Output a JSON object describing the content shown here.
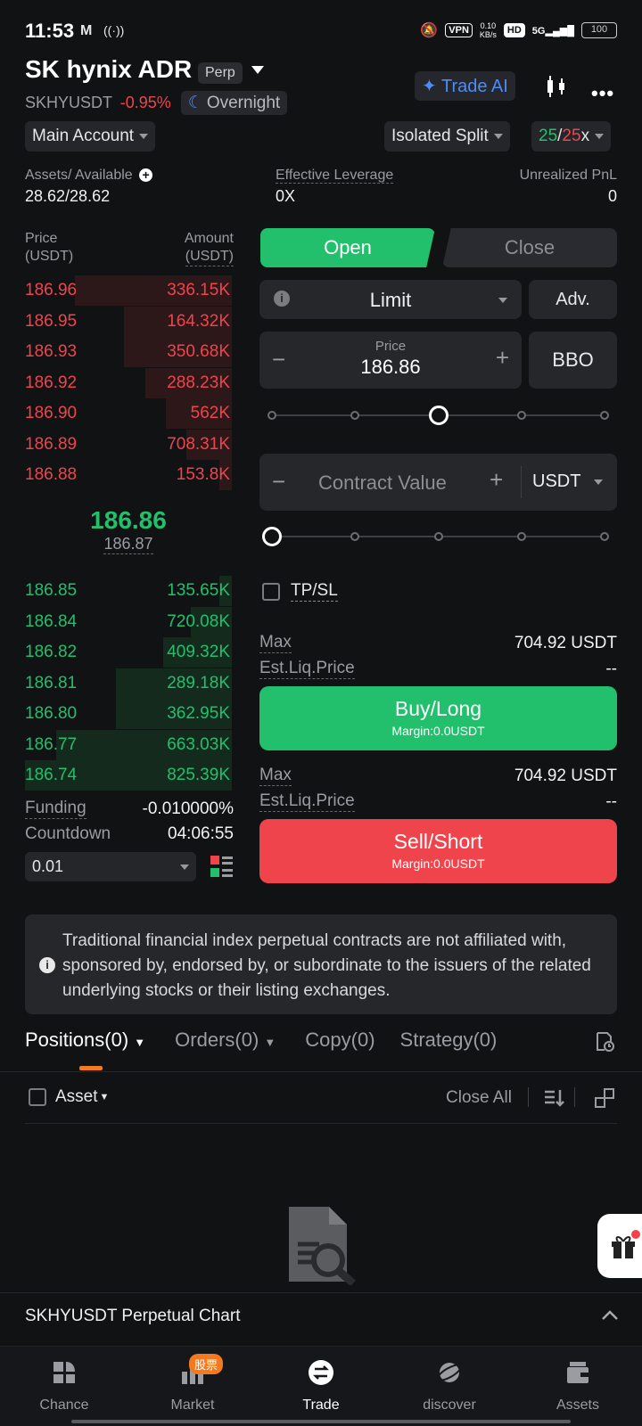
{
  "status_bar": {
    "time": "11:53",
    "net_speed_top": "0.10",
    "net_speed_bottom": "KB/s",
    "vpn": "VPN",
    "hd": "HD",
    "network": "5G",
    "battery": "100"
  },
  "header": {
    "title": "SK hynix ADR",
    "perp_tag": "Perp",
    "symbol": "SKHYUSDT",
    "change": "-0.95%",
    "session": "Overnight",
    "trade_ai": "Trade AI"
  },
  "account": {
    "main_account": "Main Account",
    "margin_mode": "Isolated Split",
    "leverage_long": "25",
    "leverage_sep": "/",
    "leverage_short": "25",
    "leverage_suffix": "x"
  },
  "info": {
    "assets_label": "Assets/ Available",
    "assets_value": "28.62/28.62",
    "eff_lev_label": "Effective Leverage",
    "eff_lev_value": "0X",
    "upnl_label": "Unrealized PnL",
    "upnl_value": "0"
  },
  "orderbook": {
    "price_header_1": "Price",
    "price_header_2": "(USDT)",
    "amount_header_1": "Amount",
    "amount_header_2": "(USDT)",
    "asks": [
      {
        "price": "186.96",
        "amount": "336.15K",
        "depth": 0.76
      },
      {
        "price": "186.95",
        "amount": "164.32K",
        "depth": 0.52
      },
      {
        "price": "186.93",
        "amount": "350.68K",
        "depth": 0.52
      },
      {
        "price": "186.92",
        "amount": "288.23K",
        "depth": 0.42
      },
      {
        "price": "186.90",
        "amount": "562K",
        "depth": 0.32
      },
      {
        "price": "186.89",
        "amount": "708.31K",
        "depth": 0.22
      },
      {
        "price": "186.88",
        "amount": "153.8K",
        "depth": 0.06
      }
    ],
    "last_price": "186.86",
    "mark_price": "186.87",
    "bids": [
      {
        "price": "186.85",
        "amount": "135.65K",
        "depth": 0.06
      },
      {
        "price": "186.84",
        "amount": "720.08K",
        "depth": 0.2
      },
      {
        "price": "186.82",
        "amount": "409.32K",
        "depth": 0.33
      },
      {
        "price": "186.81",
        "amount": "289.18K",
        "depth": 0.56
      },
      {
        "price": "186.80",
        "amount": "362.95K",
        "depth": 0.56
      },
      {
        "price": "186.77",
        "amount": "663.03K",
        "depth": 0.85
      },
      {
        "price": "186.74",
        "amount": "825.39K",
        "depth": 1.0
      }
    ],
    "funding_label": "Funding",
    "funding_value": "-0.010000%",
    "countdown_label": "Countdown",
    "countdown_value": "04:06:55",
    "precision": "0.01"
  },
  "trade": {
    "tab_open": "Open",
    "tab_close": "Close",
    "order_type": "Limit",
    "adv": "Adv.",
    "price_label": "Price",
    "price_value": "186.86",
    "bbo": "BBO",
    "contract_placeholder": "Contract Value",
    "unit": "USDT",
    "tpsl": "TP/SL",
    "buy": {
      "max_label": "Max",
      "max_value": "704.92 USDT",
      "liq_label": "Est.Liq.Price",
      "liq_value": "--",
      "button": "Buy/Long",
      "margin": "Margin:0.0USDT"
    },
    "sell": {
      "max_label": "Max",
      "max_value": "704.92 USDT",
      "liq_label": "Est.Liq.Price",
      "liq_value": "--",
      "button": "Sell/Short",
      "margin": "Margin:0.0USDT"
    }
  },
  "notice": "Traditional financial index perpetual contracts are not affiliated with, sponsored by, endorsed by, or subordinate to the issuers of the related underlying stocks or their listing exchanges.",
  "positions": {
    "tabs": [
      "Positions(0)",
      "Orders(0)",
      "Copy(0)",
      "Strategy(0)"
    ],
    "asset_filter": "Asset",
    "close_all": "Close All"
  },
  "chart_bar": "SKHYUSDT Perpetual Chart",
  "nav": {
    "items": [
      "Chance",
      "Market",
      "Trade",
      "discover",
      "Assets"
    ],
    "market_badge": "股票"
  }
}
